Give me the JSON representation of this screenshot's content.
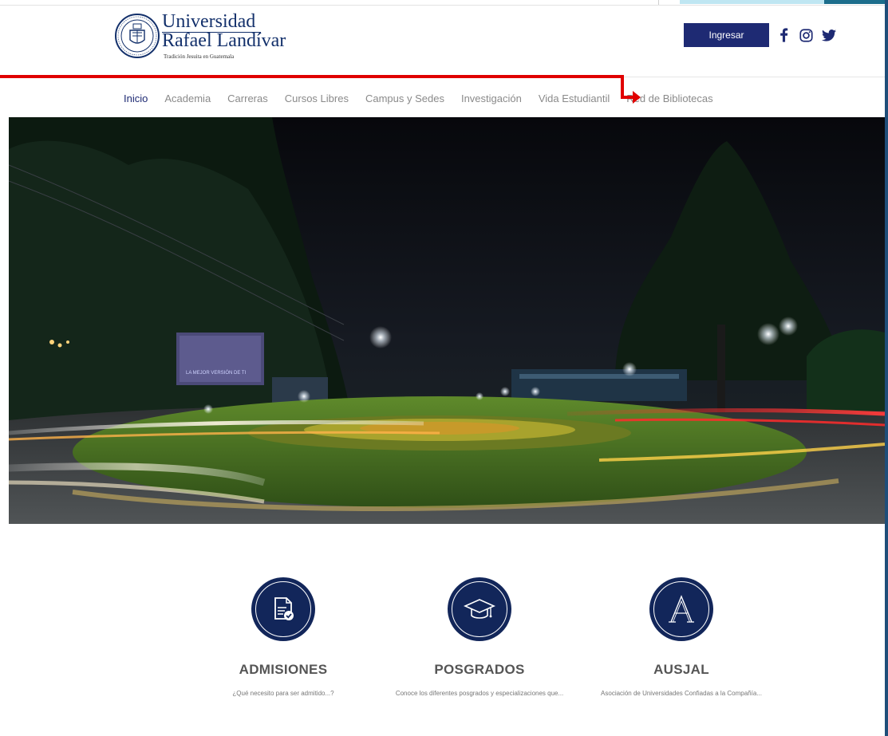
{
  "header": {
    "logo": {
      "line1": "Universidad",
      "line2": "Rafael Landívar",
      "tagline": "Tradición Jesuita en Guatemala"
    },
    "login_label": "Ingresar",
    "social_icons": [
      "facebook-icon",
      "instagram-icon",
      "twitter-icon"
    ]
  },
  "nav": {
    "items": [
      {
        "label": "Inicio",
        "active": true
      },
      {
        "label": "Academia"
      },
      {
        "label": "Carreras"
      },
      {
        "label": "Cursos Libres"
      },
      {
        "label": "Campus y Sedes"
      },
      {
        "label": "Investigación"
      },
      {
        "label": "Vida Estudiantil"
      },
      {
        "label": "Red de Bibliotecas"
      }
    ]
  },
  "hero": {
    "billboard_text": "LA MEJOR VERSIÓN DE TI"
  },
  "cards": [
    {
      "title": "ADMISIONES",
      "description": "¿Qué necesito para ser admitido...?",
      "icon": "document-check-icon"
    },
    {
      "title": "POSGRADOS",
      "description": "Conoce los diferentes posgrados y especializaciones que...",
      "icon": "graduation-cap-icon"
    },
    {
      "title": "AUSJAL",
      "description": "Asociación de Universidades Confiadas a la Compañía...",
      "icon": "letter-a-icon"
    }
  ],
  "colors": {
    "brand": "#1e2a73",
    "callout": "#e00000",
    "card_circle": "#12265a"
  }
}
